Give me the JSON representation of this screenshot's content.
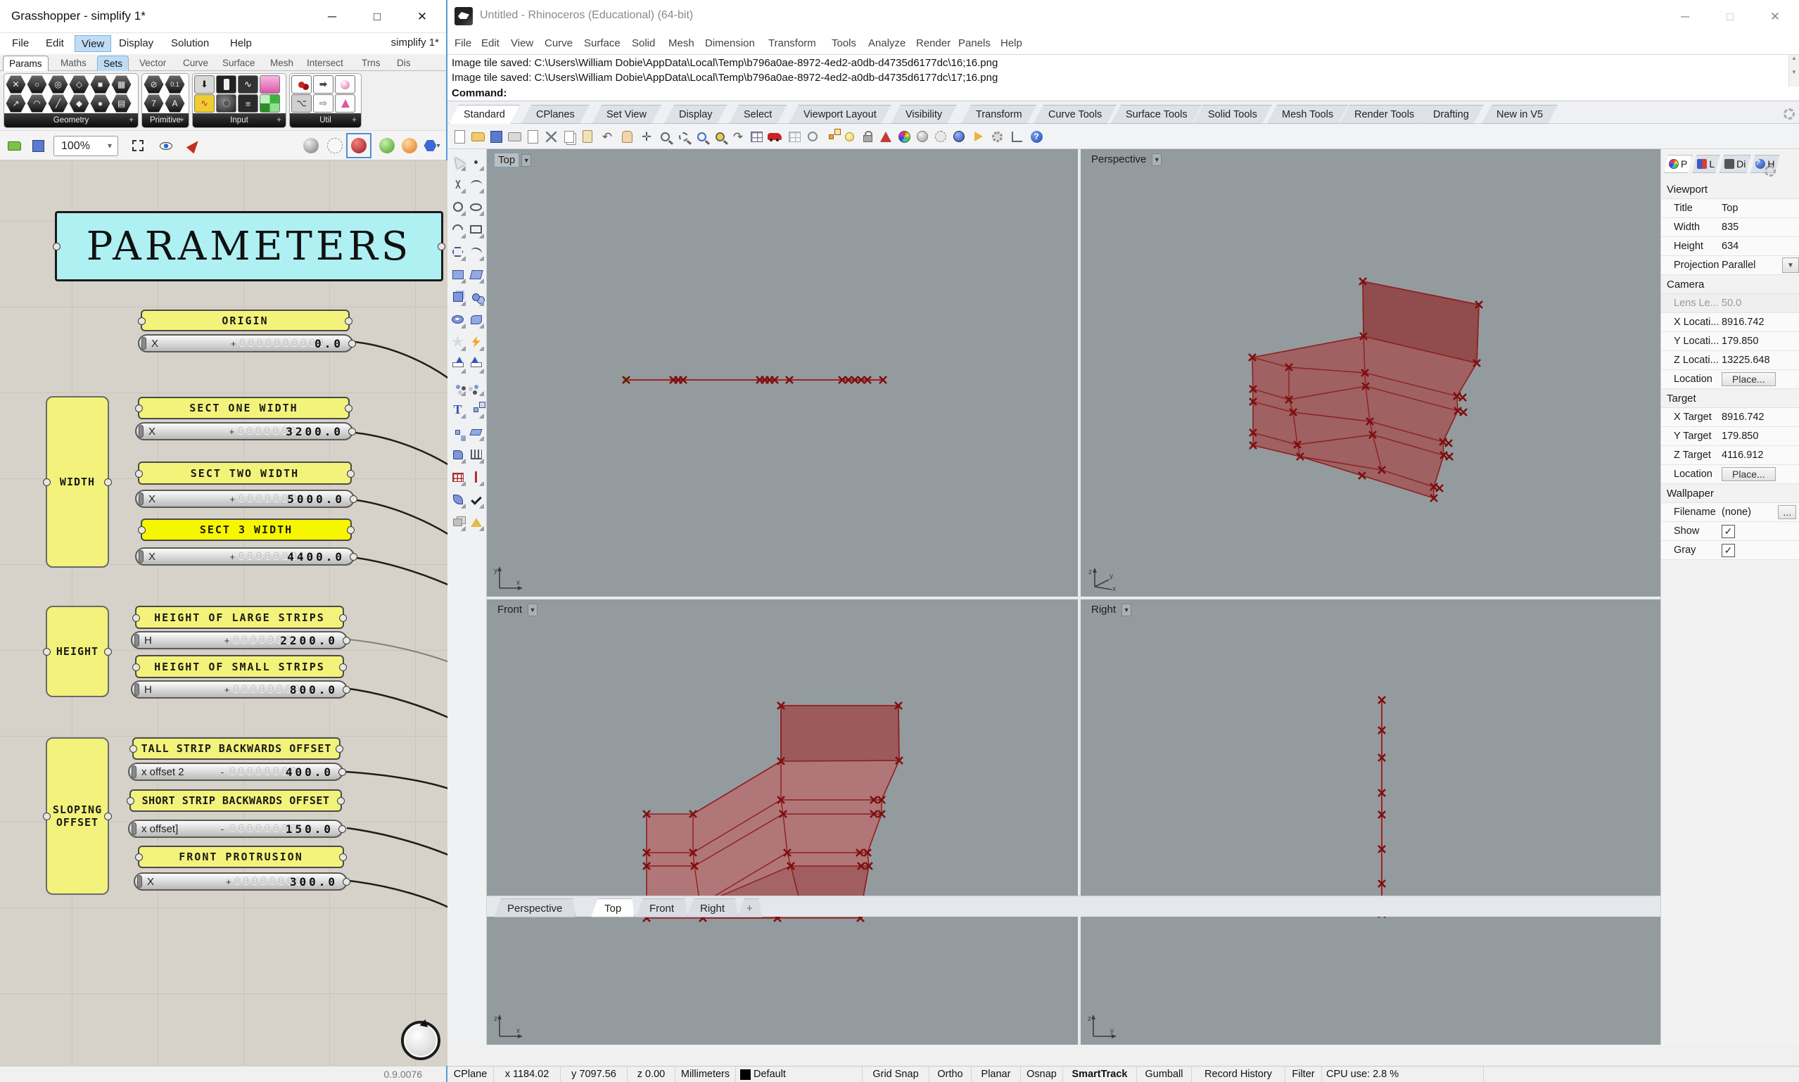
{
  "colors": {
    "gh_canvas": "#d6d2c9",
    "panel_yellow": "#f3f37b",
    "panel_yellow_bright": "#f6f600",
    "banner_cyan": "#aff0f2",
    "mesh_red": "#a63e3e",
    "viewport_gray": "#949b9f",
    "highlight_blue": "#bfdcf5"
  },
  "gh": {
    "title": "Grasshopper - simplify 1*",
    "doc_label": "simplify 1*",
    "menus": [
      "File",
      "Edit",
      "View",
      "Display",
      "Solution",
      "Help"
    ],
    "tabs": [
      "Params",
      "Maths",
      "Sets",
      "Vector",
      "Curve",
      "Surface",
      "Mesh",
      "Intersect",
      "Trns",
      "Dis"
    ],
    "ribbon_groups": [
      {
        "label": "Geometry",
        "icons": [
          "null-icon",
          "circle-icon",
          "spiral-icon",
          "plane-icon",
          "box-icon",
          "mesh-icon",
          "vector-icon",
          "arc-icon",
          "line-icon",
          "rectangle-icon",
          "brep-icon",
          "twisted-box-icon"
        ]
      },
      {
        "label": "Primitive",
        "icons": [
          "null-item-icon",
          "number-icon",
          "integer-icon",
          "text-icon"
        ]
      },
      {
        "label": "Input",
        "icons": [
          "import-icon",
          "toggle-icon",
          "graph-mapper-icon",
          "gradient-icon",
          "scribble-icon",
          "knob-icon",
          "value-list-icon",
          "colour-swatch-icon"
        ]
      },
      {
        "label": "Util",
        "icons": [
          "cherry-picker-icon",
          "relay-icon",
          "jump-icon",
          "tree-icon",
          "arrow-icon",
          "flask-icon"
        ]
      }
    ],
    "zoom_value": "100%",
    "toolbar2_icons": [
      "open-icon",
      "save-icon",
      "zoom-dropdown",
      "focus-icon",
      "preview-eye-icon",
      "sketch-pen-icon",
      "no-preview-icon",
      "wire-preview-icon",
      "shaded-preview-icon",
      "green-preview-icon",
      "custom-preview-icon",
      "selected-preview-icon"
    ],
    "canvas": {
      "banner": "PARAMETERS",
      "groups": [
        "WIDTH",
        "HEIGHT",
        "SLOPING OFFSET"
      ],
      "sliders": [
        {
          "panel": "ORIGIN",
          "param": "X",
          "sign": "+",
          "faint": "0000000000",
          "value": "0.0"
        },
        {
          "panel": "SECT ONE WIDTH",
          "param": "X",
          "sign": "+",
          "faint": "0000000",
          "value": "3200.0"
        },
        {
          "panel": "SECT TWO WIDTH",
          "param": "X",
          "sign": "+",
          "faint": "0000000",
          "value": "5000.0"
        },
        {
          "panel": "SECT 3 WIDTH",
          "param": "X",
          "sign": "+",
          "faint": "0000000",
          "value": "4400.0"
        },
        {
          "panel": "HEIGHT OF LARGE STRIPS",
          "param": "H",
          "sign": "+",
          "faint": "0000000",
          "value": "2200.0"
        },
        {
          "panel": "HEIGHT OF SMALL STRIPS",
          "param": "H",
          "sign": "+",
          "faint": "00000000",
          "value": "800.0"
        },
        {
          "panel": "TALL STRIP BACKWARDS OFFSET",
          "param": "x offset 2",
          "sign": "-",
          "faint": "00000000",
          "value": "400.0"
        },
        {
          "panel": "SHORT STRIP BACKWARDS OFFSET",
          "param": "x offset]",
          "sign": "-",
          "faint": "00000000",
          "value": "150.0"
        },
        {
          "panel": "FRONT PROTRUSION",
          "param": "X",
          "sign": "+",
          "faint": "00000000",
          "value": "300.0"
        }
      ]
    },
    "version": "0.9.0076"
  },
  "rhino": {
    "title": "Untitled - Rhinoceros (Educational) (64-bit)",
    "menus": [
      "File",
      "Edit",
      "View",
      "Curve",
      "Surface",
      "Solid",
      "Mesh",
      "Dimension",
      "Transform",
      "Tools",
      "Analyze",
      "Render",
      "Panels",
      "Help"
    ],
    "command_history": [
      "Image tile saved: C:\\Users\\William Dobie\\AppData\\Local\\Temp\\b796a0ae-8972-4ed2-a0db-d4735d6177dc\\16;16.png",
      "Image tile saved: C:\\Users\\William Dobie\\AppData\\Local\\Temp\\b796a0ae-8972-4ed2-a0db-d4735d6177dc\\17;16.png"
    ],
    "command_prompt": "Command:",
    "tabs": [
      "Standard",
      "CPlanes",
      "Set View",
      "Display",
      "Select",
      "Viewport Layout",
      "Visibility",
      "Transform",
      "Curve Tools",
      "Surface Tools",
      "Solid Tools",
      "Mesh Tools",
      "Render Tools",
      "Drafting",
      "New in V5"
    ],
    "toolbar_icons": [
      "new-file-icon",
      "open-icon",
      "save-icon",
      "print-icon",
      "edit-note-icon",
      "cut-icon",
      "copy-icon",
      "paste-icon",
      "undo-icon",
      "pan-icon",
      "rotate-view-icon",
      "zoom-in-icon",
      "zoom-dynamic-icon",
      "zoom-window-icon",
      "zoom-selected-icon",
      "undo-view-icon",
      "viewport-layout-icon",
      "named-view-icon",
      "object-visibility-icon",
      "circle-center-icon",
      "control-points-icon",
      "lamp-icon",
      "lock-icon",
      "layer-cone-icon",
      "color-wheel-icon",
      "shaded-sphere-icon",
      "wireframe-sphere-icon",
      "rendered-sphere-icon",
      "notification-flag-icon",
      "options-gear-icon",
      "gumball-widget-icon",
      "help-icon"
    ],
    "viewports": [
      {
        "label": "Top"
      },
      {
        "label": "Perspective"
      },
      {
        "label": "Front"
      },
      {
        "label": "Right"
      }
    ],
    "viewport_tabs": [
      "Perspective",
      "Top",
      "Front",
      "Right"
    ],
    "new_tab_button": "+",
    "panel": {
      "tabs": [
        {
          "label": "P",
          "icon": "color-wheel-icon"
        },
        {
          "label": "L",
          "icon": "layer-cone-icon"
        },
        {
          "label": "Di",
          "icon": "display-monitor-icon"
        },
        {
          "label": "H",
          "icon": "help-icon"
        }
      ],
      "sections": [
        {
          "title": "Viewport",
          "rows": [
            {
              "label": "Title",
              "value": "Top"
            },
            {
              "label": "Width",
              "value": "835"
            },
            {
              "label": "Height",
              "value": "634"
            },
            {
              "label": "Projection",
              "value": "Parallel"
            }
          ]
        },
        {
          "title": "Camera",
          "rows": [
            {
              "label": "Lens Le...",
              "value": "50.0"
            },
            {
              "label": "X Locati...",
              "value": "8916.742"
            },
            {
              "label": "Y Locati...",
              "value": "179.850"
            },
            {
              "label": "Z Locati...",
              "value": "13225.648"
            },
            {
              "label": "Location",
              "value": "Place..."
            }
          ]
        },
        {
          "title": "Target",
          "rows": [
            {
              "label": "X Target",
              "value": "8916.742"
            },
            {
              "label": "Y Target",
              "value": "179.850"
            },
            {
              "label": "Z Target",
              "value": "4116.912"
            },
            {
              "label": "Location",
              "value": "Place..."
            }
          ]
        },
        {
          "title": "Wallpaper",
          "rows": [
            {
              "label": "Filename",
              "value": "(none)",
              "browse": "..."
            },
            {
              "label": "Show",
              "value": "✓"
            },
            {
              "label": "Gray",
              "value": "✓"
            }
          ]
        }
      ]
    },
    "status": [
      {
        "label": "CPlane"
      },
      {
        "label": "x 1184.02"
      },
      {
        "label": "y 7097.56"
      },
      {
        "label": "z 0.00"
      },
      {
        "label": "Millimeters"
      },
      {
        "label": "Default"
      },
      {
        "label": "Grid Snap"
      },
      {
        "label": "Ortho"
      },
      {
        "label": "Planar"
      },
      {
        "label": "Osnap"
      },
      {
        "label": "SmartTrack"
      },
      {
        "label": "Gumball"
      },
      {
        "label": "Record History"
      },
      {
        "label": "Filter"
      },
      {
        "label": "CPU use: 2.8 %"
      }
    ]
  }
}
